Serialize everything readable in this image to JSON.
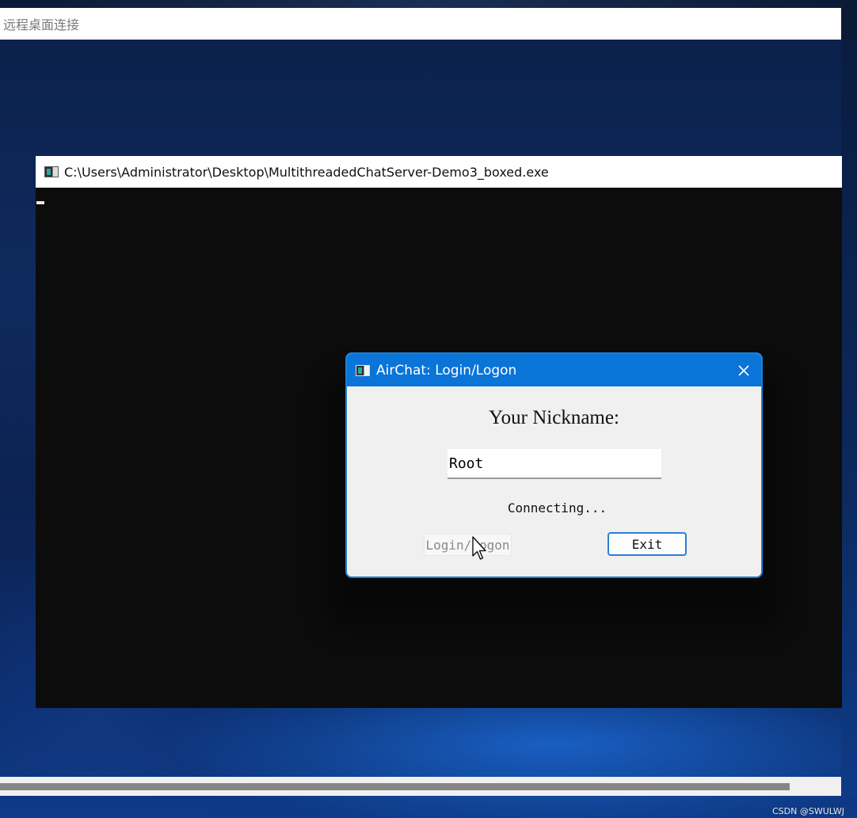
{
  "rdp_window": {
    "title": "远程桌面连接"
  },
  "console_window": {
    "title": "C:\\Users\\Administrator\\Desktop\\MultithreadedChatServer-Demo3_boxed.exe"
  },
  "dialog": {
    "title": "AirChat: Login/Logon",
    "close_icon": "close-icon",
    "nickname_label": "Your Nickname:",
    "nickname_value": "Root",
    "status": "Connecting...",
    "login_button": "Login/Logon",
    "exit_button": "Exit"
  },
  "watermark": "CSDN @SWULWJ",
  "colors": {
    "dialog_titlebar": "#0a74d8",
    "dialog_border": "#1a7fd6",
    "exit_button_border": "#2b7fd6",
    "console_background": "#0c0c0c"
  }
}
